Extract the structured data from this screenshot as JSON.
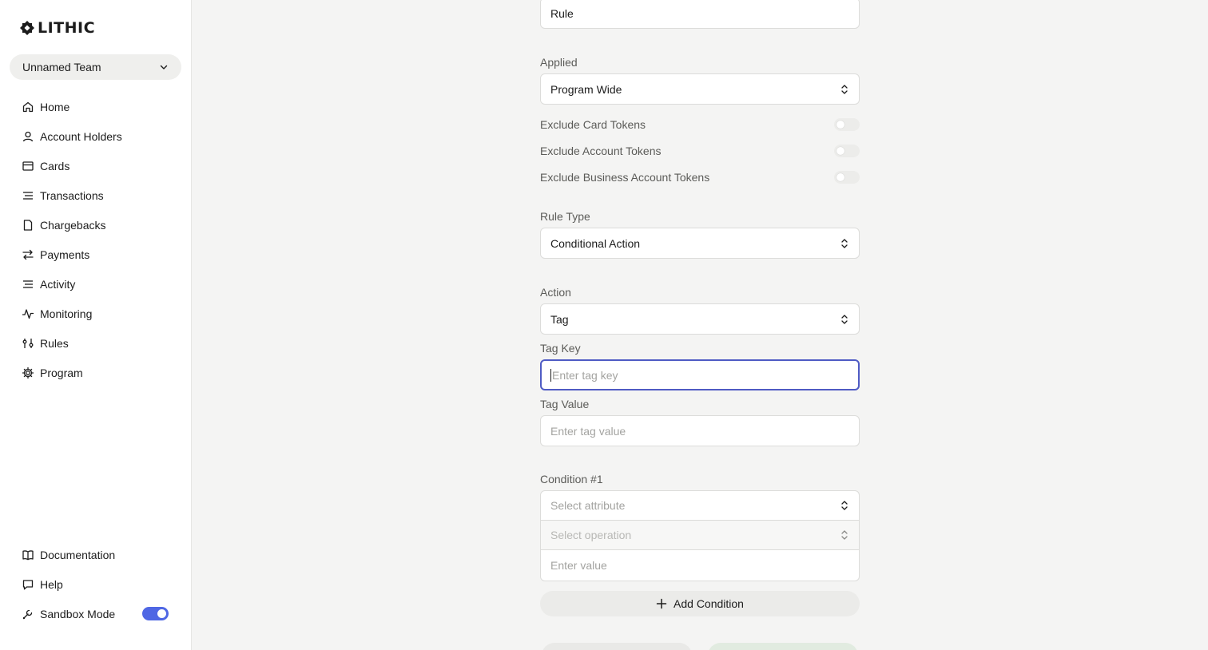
{
  "brand": {
    "name": "LITHIC"
  },
  "team": {
    "name": "Unnamed Team"
  },
  "nav": {
    "items": [
      {
        "label": "Home",
        "icon": "home-icon"
      },
      {
        "label": "Account Holders",
        "icon": "user-icon"
      },
      {
        "label": "Cards",
        "icon": "card-icon"
      },
      {
        "label": "Transactions",
        "icon": "list-icon"
      },
      {
        "label": "Chargebacks",
        "icon": "document-icon"
      },
      {
        "label": "Payments",
        "icon": "arrows-icon"
      },
      {
        "label": "Activity",
        "icon": "list-icon"
      },
      {
        "label": "Monitoring",
        "icon": "pulse-icon"
      },
      {
        "label": "Rules",
        "icon": "sliders-icon"
      },
      {
        "label": "Program",
        "icon": "gear-icon"
      }
    ],
    "bottom": [
      {
        "label": "Documentation",
        "icon": "book-icon"
      },
      {
        "label": "Help",
        "icon": "chat-icon"
      },
      {
        "label": "Sandbox Mode",
        "icon": "wrench-icon",
        "toggle": true
      }
    ]
  },
  "form": {
    "name_value": "Rule",
    "applied_label": "Applied",
    "applied_value": "Program Wide",
    "exclusions": [
      {
        "label": "Exclude Card Tokens",
        "on": false
      },
      {
        "label": "Exclude Account Tokens",
        "on": false
      },
      {
        "label": "Exclude Business Account Tokens",
        "on": false
      }
    ],
    "rule_type_label": "Rule Type",
    "rule_type_value": "Conditional Action",
    "action_label": "Action",
    "action_value": "Tag",
    "tag_key_label": "Tag Key",
    "tag_key_placeholder": "Enter tag key",
    "tag_value_label": "Tag Value",
    "tag_value_placeholder": "Enter tag value",
    "condition_label": "Condition #1",
    "attribute_placeholder": "Select attribute",
    "operation_placeholder": "Select operation",
    "value_placeholder": "Enter value",
    "add_condition_label": "Add Condition"
  },
  "colors": {
    "accent": "#4f67e4",
    "focus": "#4f5bc4"
  }
}
